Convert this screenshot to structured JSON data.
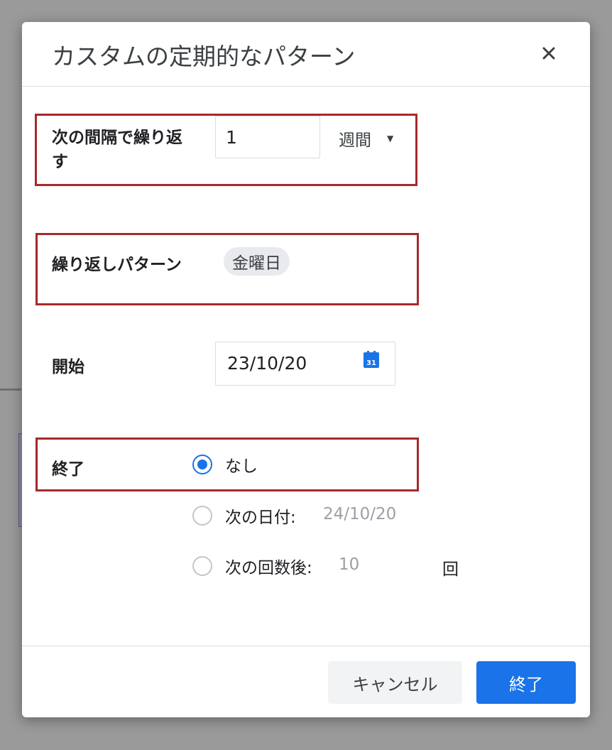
{
  "dialog": {
    "title": "カスタムの定期的なパターン",
    "close_icon": "close-icon"
  },
  "repeat_every": {
    "label_line1": "次の間隔で繰り返",
    "label_line2": "す",
    "interval_value": "1",
    "unit_selected": "週間",
    "unit_caret_icon": "caret-down-icon"
  },
  "repeat_on": {
    "label": "繰り返しパターン",
    "day_chip": "金曜日"
  },
  "start": {
    "label": "開始",
    "date": "23/10/20",
    "calendar_icon": "calendar-icon",
    "calendar_icon_text": "31"
  },
  "end": {
    "label": "終了",
    "options": [
      {
        "label": "なし",
        "checked": true
      },
      {
        "label": "次の日付:",
        "value": "24/10/20",
        "checked": false
      },
      {
        "label": "次の回数後:",
        "value": "10",
        "suffix": "回",
        "checked": false
      }
    ]
  },
  "footer": {
    "cancel_label": "キャンセル",
    "done_label": "終了"
  },
  "colors": {
    "accent": "#1a73e8",
    "highlight_border": "#a52a2a"
  }
}
